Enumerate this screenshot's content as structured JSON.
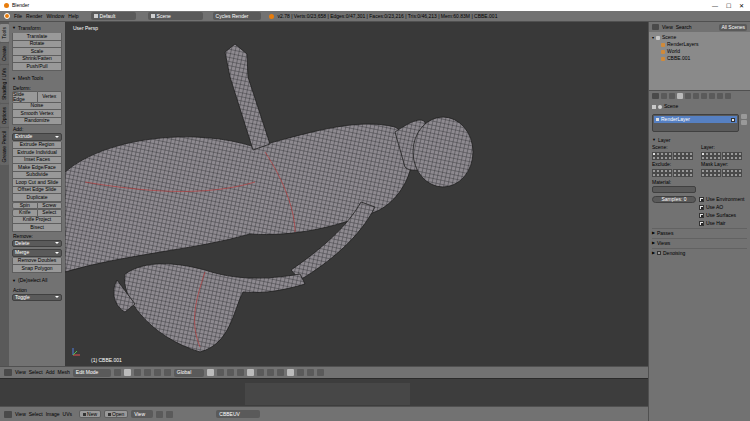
{
  "window": {
    "title": "Blender",
    "controls": [
      "—",
      "☐",
      "✕"
    ]
  },
  "info_header": {
    "menus": [
      "File",
      "Render",
      "Window",
      "Help"
    ],
    "layout": "Default",
    "scene": "Scene",
    "engine": "Cycles Render",
    "stats": "v2.78 | Verts:0/23,658 | Edges:0/47,301 | Faces:0/23,216 | Tris:0/46,213 | Mem:60.83M | CBBE.001"
  },
  "tool_tabs": [
    {
      "label": "Tools",
      "selected": true
    },
    {
      "label": "Create",
      "selected": false
    },
    {
      "label": "Shading / UVs",
      "selected": false
    },
    {
      "label": "Options",
      "selected": false
    },
    {
      "label": "Grease Pencil",
      "selected": false
    }
  ],
  "tool_shelf": {
    "panels": [
      {
        "title": "Transform",
        "expanded": true,
        "rows": [
          {
            "kind": "button",
            "label": "Translate"
          },
          {
            "kind": "button",
            "label": "Rotate"
          },
          {
            "kind": "button",
            "label": "Scale"
          },
          {
            "kind": "button",
            "label": "Shrink/Fatten"
          },
          {
            "kind": "button",
            "label": "Push/Pull"
          }
        ]
      },
      {
        "title": "Mesh Tools",
        "expanded": true,
        "rows": [
          {
            "kind": "label",
            "label": "Deform:"
          },
          {
            "kind": "pair",
            "labels": [
              "Slide Edge",
              "Vertex"
            ]
          },
          {
            "kind": "button",
            "label": "Noise"
          },
          {
            "kind": "button",
            "label": "Smooth Vertex"
          },
          {
            "kind": "button",
            "label": "Randomize"
          },
          {
            "kind": "label",
            "label": "Add:"
          },
          {
            "kind": "dropdown",
            "label": "Extrude"
          },
          {
            "kind": "button",
            "label": "Extrude Region"
          },
          {
            "kind": "button",
            "label": "Extrude Individual"
          },
          {
            "kind": "button",
            "label": "Inset Faces"
          },
          {
            "kind": "button",
            "label": "Make Edge/Face"
          },
          {
            "kind": "button",
            "label": "Subdivide"
          },
          {
            "kind": "button",
            "label": "Loop Cut and Slide"
          },
          {
            "kind": "button",
            "label": "Offset Edge Slide"
          },
          {
            "kind": "button",
            "label": "Duplicate"
          },
          {
            "kind": "pair",
            "labels": [
              "Spin",
              "Screw"
            ]
          },
          {
            "kind": "pair",
            "labels": [
              "Knife",
              "Select"
            ]
          },
          {
            "kind": "button",
            "label": "Knife Project"
          },
          {
            "kind": "button",
            "label": "Bisect"
          },
          {
            "kind": "label",
            "label": "Remove:"
          },
          {
            "kind": "dropdown",
            "label": "Delete"
          },
          {
            "kind": "dropdown",
            "label": "Merge"
          },
          {
            "kind": "button",
            "label": "Remove Doubles"
          },
          {
            "kind": "button",
            "label": "Snap Polygon"
          }
        ]
      },
      {
        "title": "(De)select All",
        "expanded": true,
        "rows": [
          {
            "kind": "label",
            "label": "Action"
          },
          {
            "kind": "dropdown",
            "label": "Toggle"
          }
        ]
      }
    ]
  },
  "viewport": {
    "view_label": "User Persp",
    "object_label": "(1) CBBE.001"
  },
  "viewport_header": {
    "menus": [
      "View",
      "Select",
      "Add",
      "Mesh"
    ],
    "mode": "Edit Mode",
    "orientation": "Global"
  },
  "uv_header": {
    "menus": [
      "View",
      "Select",
      "Image",
      "UVs"
    ],
    "buttons": [
      "New",
      "Open"
    ],
    "view": "View",
    "uv_map": "CBBEUV"
  },
  "outliner": {
    "menus": [
      "View",
      "Search"
    ],
    "filter": "All Scenes",
    "items": [
      {
        "label": "Scene",
        "expanded": true,
        "selected": false,
        "children": [
          {
            "label": "RenderLayers",
            "selected": false
          },
          {
            "label": "World",
            "selected": false
          },
          {
            "label": "CBBE.001",
            "selected": false
          }
        ]
      }
    ]
  },
  "properties": {
    "context": "Scene",
    "layers": [
      {
        "label": "RenderLayer",
        "selected": true,
        "enabled": true
      }
    ],
    "layer_panel": {
      "title": "Layer",
      "expanded": true,
      "grids": [
        {
          "label": "Scene:",
          "cells": [
            true,
            false,
            false,
            false,
            false,
            false,
            false,
            false,
            false,
            false,
            false,
            false,
            false,
            false,
            false,
            false,
            false,
            false,
            false,
            false
          ]
        },
        {
          "label": "Layer:",
          "cells": [
            true,
            false,
            false,
            false,
            false,
            false,
            false,
            false,
            false,
            false,
            false,
            false,
            false,
            false,
            false,
            false,
            false,
            false,
            false,
            false
          ]
        },
        {
          "label": "Exclude:",
          "cells": [
            false,
            false,
            false,
            false,
            false,
            false,
            false,
            false,
            false,
            false,
            false,
            false,
            false,
            false,
            false,
            false,
            false,
            false,
            false,
            false
          ]
        },
        {
          "label": "Mask Layer:",
          "cells": [
            false,
            false,
            false,
            false,
            false,
            false,
            false,
            false,
            false,
            false,
            false,
            false,
            false,
            false,
            false,
            false,
            false,
            false,
            false,
            false
          ]
        }
      ],
      "material_label": "Material:",
      "samples": "Samples: 0",
      "options": [
        {
          "label": "Use Environment",
          "checked": true
        },
        {
          "label": "Use AO",
          "checked": true
        },
        {
          "label": "Use Surfaces",
          "checked": true
        },
        {
          "label": "Use Hair",
          "checked": true
        }
      ]
    },
    "collapsed_panels": [
      {
        "title": "Passes",
        "expanded": false
      },
      {
        "title": "Views",
        "expanded": false
      },
      {
        "title": "Denoising",
        "expanded": false
      }
    ]
  }
}
